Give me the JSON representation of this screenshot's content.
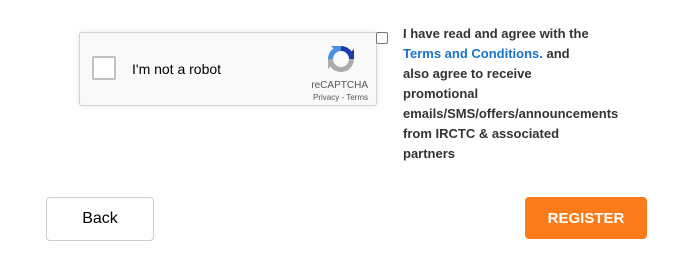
{
  "captcha": {
    "label": "I'm not a robot",
    "brand": "reCAPTCHA",
    "privacy_link": "Privacy",
    "separator": " - ",
    "terms_link": "Terms",
    "logo_icon": "recaptcha-logo-icon"
  },
  "agreement": {
    "line1": "I have read and agree with the",
    "terms_link": "Terms and Conditions.",
    "line2_suffix": " and",
    "line3": "also agree to receive",
    "line4": "promotional",
    "line5": "emails/SMS/offers/announcements",
    "line6": "from IRCTC & associated",
    "line7": "partners"
  },
  "buttons": {
    "back_label": "Back",
    "register_label": "REGISTER"
  },
  "colors": {
    "register_bg": "#fb7a1a",
    "link": "#1a73c8"
  }
}
